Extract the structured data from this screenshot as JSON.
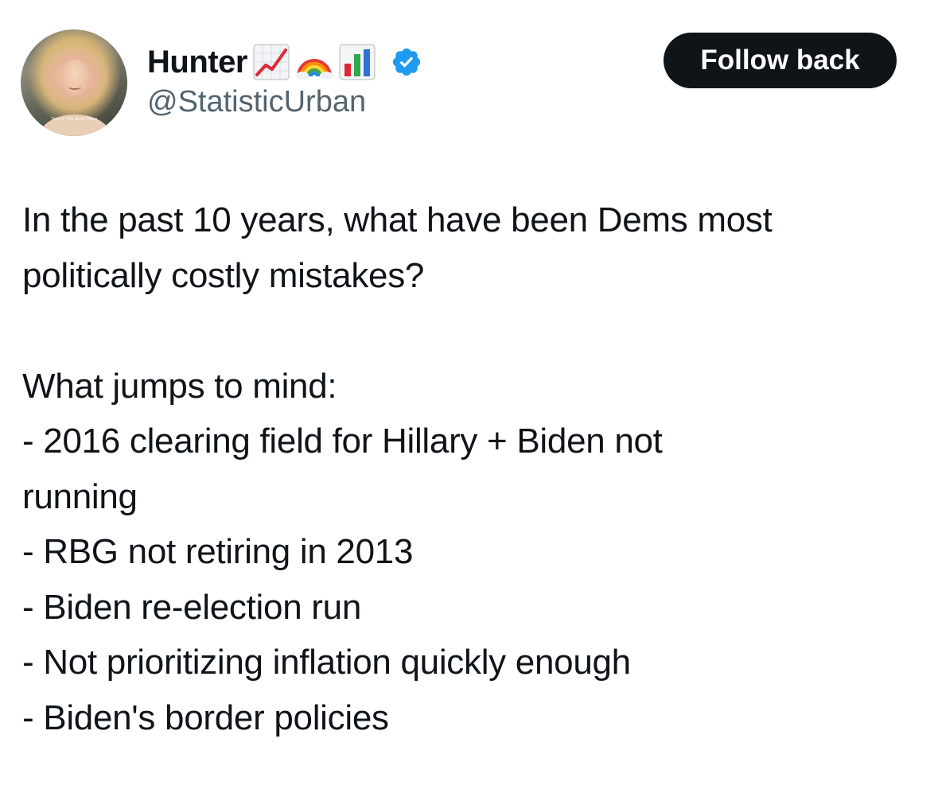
{
  "author": {
    "display_name": "Hunter",
    "handle": "@StatisticUrban",
    "name_emojis": [
      "chart-increasing-icon",
      "rainbow-icon",
      "bar-chart-icon"
    ],
    "verified": true,
    "verified_color": "#1d9bf0",
    "avatar_caption": "This is The Best Place"
  },
  "follow_button": {
    "label": "Follow back",
    "background": "#0f1419",
    "text_color": "#ffffff"
  },
  "tweet": {
    "question_lines": [
      "In the past 10 years, what have been Dems most",
      "politically costly mistakes?"
    ],
    "list_intro": "What jumps to mind:",
    "items": [
      [
        "- 2016 clearing field for Hillary + Biden not",
        "running"
      ],
      [
        "- RBG not retiring in 2013"
      ],
      [
        "- Biden re-election run"
      ],
      [
        "- Not prioritizing inflation quickly enough"
      ],
      [
        "- Biden's border policies"
      ]
    ]
  },
  "colors": {
    "text_primary": "#0f1419",
    "text_secondary": "#536471",
    "background": "#ffffff"
  }
}
